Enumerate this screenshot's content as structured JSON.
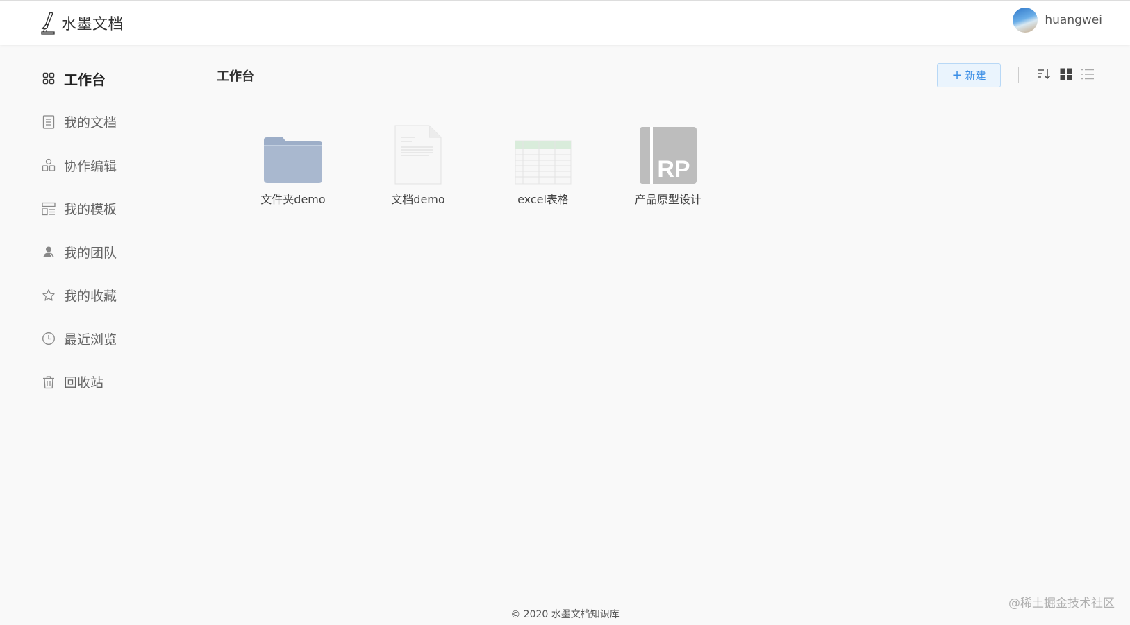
{
  "header": {
    "app_title": "水墨文档",
    "user_name": "huangwei"
  },
  "sidebar": {
    "items": [
      {
        "label": "工作台",
        "icon": "grid-icon",
        "active": true
      },
      {
        "label": "我的文档",
        "icon": "document-list-icon"
      },
      {
        "label": "协作编辑",
        "icon": "collaborate-icon"
      },
      {
        "label": "我的模板",
        "icon": "template-icon"
      },
      {
        "label": "我的团队",
        "icon": "team-icon"
      },
      {
        "label": "我的收藏",
        "icon": "star-icon"
      },
      {
        "label": "最近浏览",
        "icon": "clock-icon"
      },
      {
        "label": "回收站",
        "icon": "trash-icon"
      }
    ]
  },
  "main": {
    "title": "工作台",
    "new_button_label": "新建",
    "files": [
      {
        "name": "文件夹demo",
        "icon": "folder-icon"
      },
      {
        "name": "文档demo",
        "icon": "document-icon"
      },
      {
        "name": "excel表格",
        "icon": "spreadsheet-icon"
      },
      {
        "name": "产品原型设计",
        "icon": "rp-prototype-icon"
      }
    ]
  },
  "footer": {
    "copyright": "© 2020 水墨文档知识库",
    "watermark": "@稀土掘金技术社区"
  },
  "colors": {
    "accent": "#3a8ee6",
    "accent_bg": "#eaf4fd",
    "page_bg": "#f9f9f9",
    "folder": "#a9b8cf",
    "rp_gray": "#bdbdbd"
  }
}
